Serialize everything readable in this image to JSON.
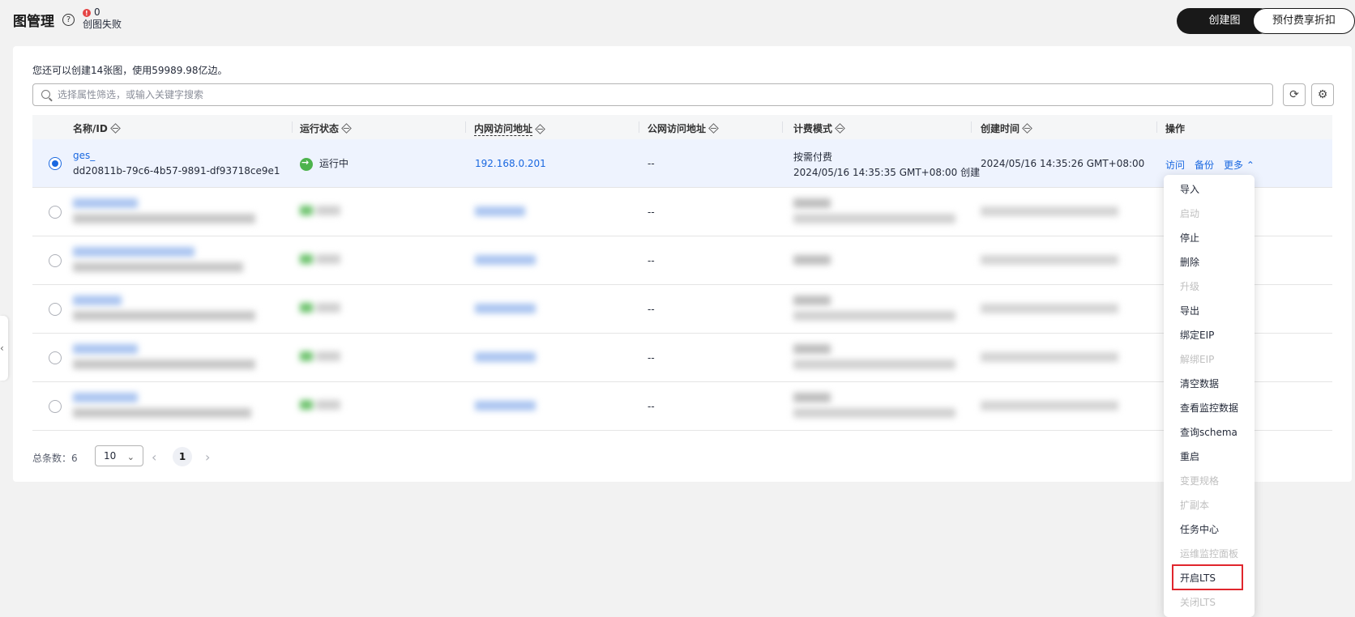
{
  "header": {
    "title": "图管理",
    "help": "?",
    "fail_count": "0",
    "fail_label": "创图失败",
    "create_btn": "创建图",
    "prepaid_btn": "预付费享折扣"
  },
  "quota_text": "您还可以创建14张图，使用59989.98亿边。",
  "search": {
    "placeholder": "选择属性筛选，或输入关键字搜索"
  },
  "columns": {
    "name": "名称/ID",
    "status": "运行状态",
    "private_addr": "内网访问地址",
    "public_addr": "公网访问地址",
    "billing": "计费模式",
    "created": "创建时间",
    "actions": "操作"
  },
  "selected_row": {
    "name": "ges_",
    "id": "dd20811b-79c6-4b57-9891-df93718ce9e1",
    "status": "运行中",
    "private_ip": "192.168.0.201",
    "public_ip": "--",
    "billing": "按需付费",
    "billing_detail": "2024/05/16 14:35:35 GMT+08:00 创建",
    "created": "2024/05/16 14:35:26 GMT+08:00",
    "action_visit": "访问",
    "action_backup": "备份",
    "action_more": "更多"
  },
  "other_rows_public": [
    "--",
    "--",
    "--",
    "--",
    "--"
  ],
  "pager": {
    "total_label": "总条数：",
    "total": "6",
    "page_size": "10",
    "current_page": "1"
  },
  "more_menu": [
    {
      "label": "导入",
      "enabled": true
    },
    {
      "label": "启动",
      "enabled": false
    },
    {
      "label": "停止",
      "enabled": true
    },
    {
      "label": "删除",
      "enabled": true
    },
    {
      "label": "升级",
      "enabled": false
    },
    {
      "label": "导出",
      "enabled": true
    },
    {
      "label": "绑定EIP",
      "enabled": true
    },
    {
      "label": "解绑EIP",
      "enabled": false
    },
    {
      "label": "清空数据",
      "enabled": true
    },
    {
      "label": "查看监控数据",
      "enabled": true
    },
    {
      "label": "查询schema",
      "enabled": true
    },
    {
      "label": "重启",
      "enabled": true
    },
    {
      "label": "变更规格",
      "enabled": false
    },
    {
      "label": "扩副本",
      "enabled": false
    },
    {
      "label": "任务中心",
      "enabled": true
    },
    {
      "label": "运维监控面板",
      "enabled": false
    },
    {
      "label": "开启LTS",
      "enabled": true
    },
    {
      "label": "关闭LTS",
      "enabled": false
    }
  ],
  "colors": {
    "accent": "#1a68e0",
    "running": "#4db34d",
    "highlight": "#e0262d",
    "primary_btn": "#191919"
  }
}
